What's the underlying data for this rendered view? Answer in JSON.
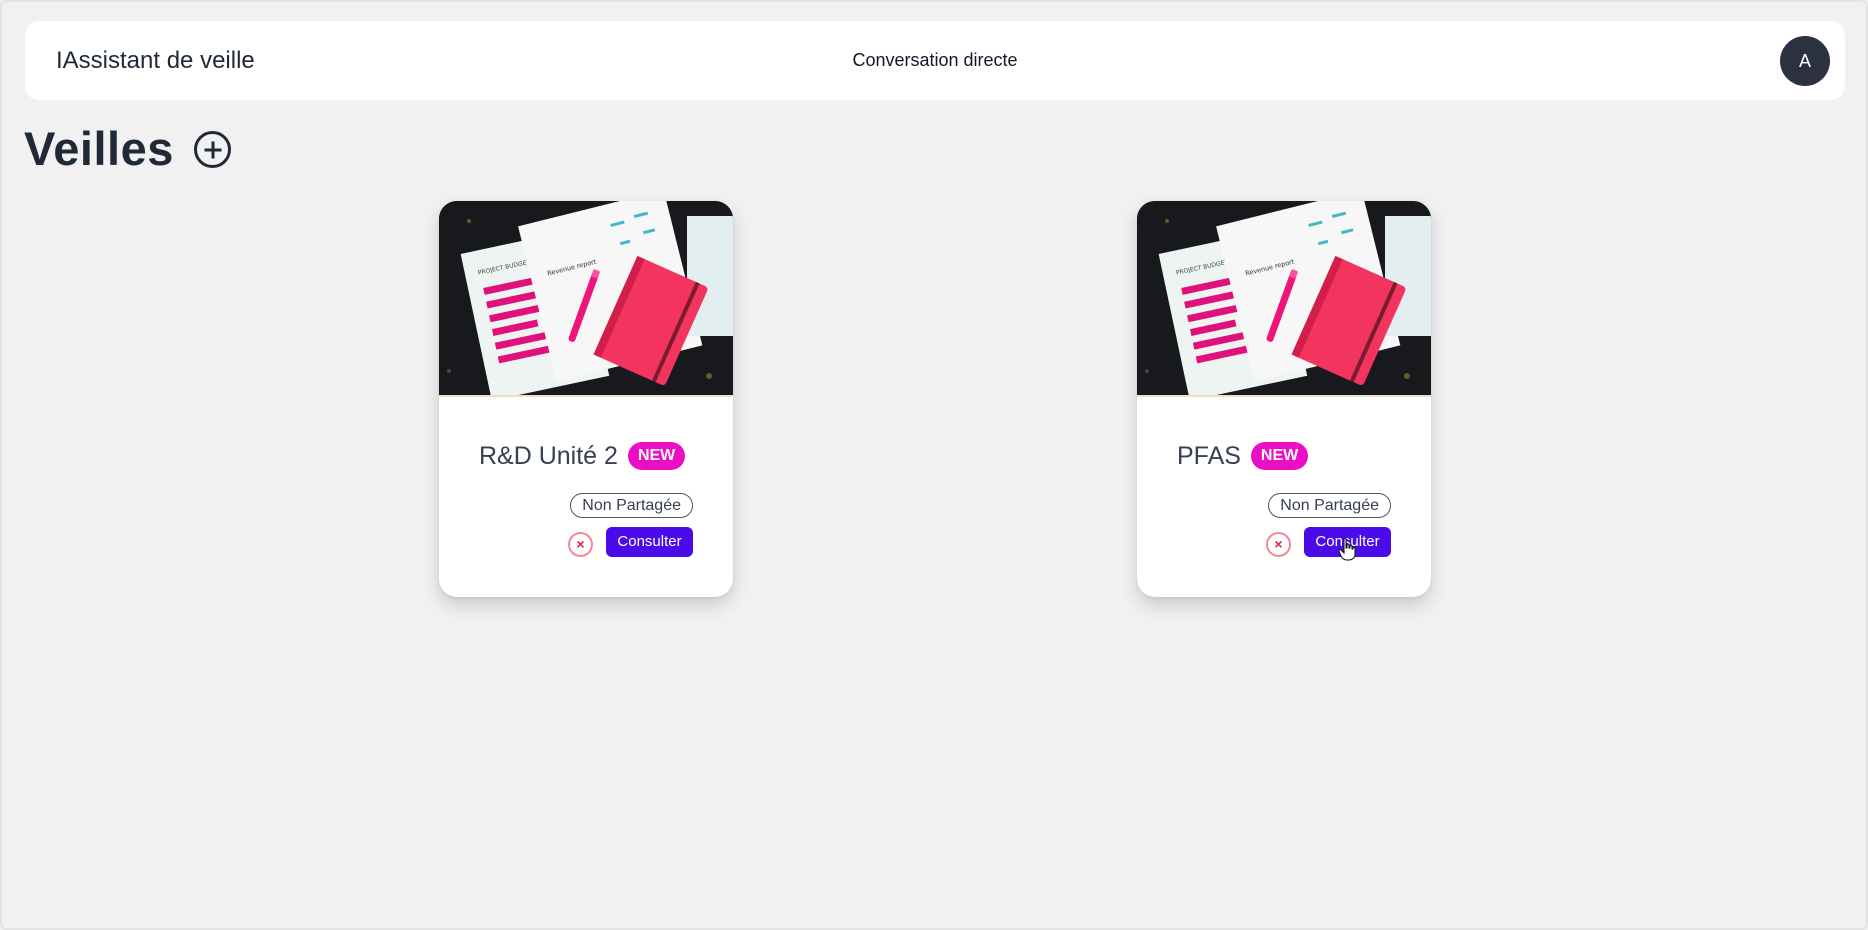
{
  "header": {
    "brand": "IAssistant de veille",
    "nav_link": "Conversation directe",
    "avatar_initial": "A"
  },
  "page": {
    "title": "Veilles",
    "add_icon": "plus-circle-icon"
  },
  "cards": [
    {
      "title": "R&D Unité 2",
      "badge": "NEW",
      "share_status": "Non Partagée",
      "consult_label": "Consulter",
      "delete_icon": "close-circle-icon",
      "image_texts": {
        "doc_heading": "Revenue report",
        "mini_title": "PROJECT BUDGET"
      }
    },
    {
      "title": "PFAS",
      "badge": "NEW",
      "share_status": "Non Partagée",
      "consult_label": "Consulter",
      "delete_icon": "close-circle-icon",
      "image_texts": {
        "doc_heading": "Revenue report",
        "mini_title": "PROJECT BUDGET"
      }
    }
  ],
  "colors": {
    "background": "#f1f1f1",
    "accent_button": "#4b0ae8",
    "badge_new": "#ea0fc5",
    "delete_icon": "#e0204a",
    "text_dark": "#1f2937"
  }
}
